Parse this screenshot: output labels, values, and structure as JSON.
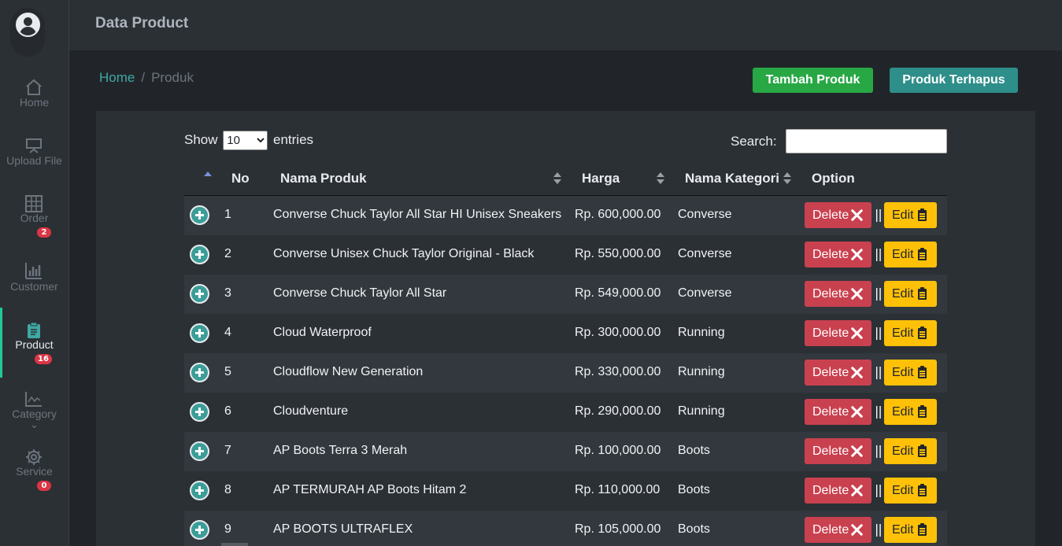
{
  "header": {
    "title": "Data Product"
  },
  "sidebar": {
    "items": [
      {
        "label": "Home",
        "icon": "home-icon"
      },
      {
        "label": "Upload File",
        "icon": "presentation-icon"
      },
      {
        "label": "Order",
        "icon": "grid-icon",
        "badge": "2"
      },
      {
        "label": "Customer",
        "icon": "bar-chart-icon"
      },
      {
        "label": "Product",
        "icon": "clipboard-icon",
        "badge": "16",
        "active": true
      },
      {
        "label": "Category",
        "icon": "line-chart-icon",
        "caret": "⌄"
      },
      {
        "label": "Service",
        "icon": "gear-icon",
        "badge": "0"
      }
    ]
  },
  "breadcrumb": {
    "home": "Home",
    "separator": "/",
    "current": "Produk"
  },
  "actions": {
    "add_label": "Tambah Produk",
    "deleted_label": "Produk Terhapus"
  },
  "table_controls": {
    "show_label": "Show",
    "entries_value": "10",
    "entries_label": "entries",
    "search_label": "Search:",
    "search_value": ""
  },
  "table": {
    "columns": [
      "No",
      "Nama Produk",
      "Harga",
      "Nama Kategori",
      "Option"
    ],
    "delete_label": "Delete",
    "edit_label": "Edit",
    "separator": "||",
    "rows": [
      {
        "no": "1",
        "name": "Converse Chuck Taylor All Star HI Unisex Sneakers",
        "price": "Rp. 600,000.00",
        "category": "Converse"
      },
      {
        "no": "2",
        "name": "Converse Unisex Chuck Taylor Original - Black",
        "price": "Rp. 550,000.00",
        "category": "Converse"
      },
      {
        "no": "3",
        "name": "Converse Chuck Taylor All Star",
        "price": "Rp. 549,000.00",
        "category": "Converse"
      },
      {
        "no": "4",
        "name": "Cloud Waterproof",
        "price": "Rp. 300,000.00",
        "category": "Running"
      },
      {
        "no": "5",
        "name": "Cloudflow New Generation",
        "price": "Rp. 330,000.00",
        "category": "Running"
      },
      {
        "no": "6",
        "name": "Cloudventure",
        "price": "Rp. 290,000.00",
        "category": "Running"
      },
      {
        "no": "7",
        "name": "AP Boots Terra 3 Merah",
        "price": "Rp. 100,000.00",
        "category": "Boots"
      },
      {
        "no": "8",
        "name": "AP TERMURAH AP Boots Hitam 2",
        "price": "Rp. 110,000.00",
        "category": "Boots"
      },
      {
        "no": "9",
        "name": "AP BOOTS ULTRAFLEX",
        "price": "Rp. 105,000.00",
        "category": "Boots"
      }
    ]
  }
}
